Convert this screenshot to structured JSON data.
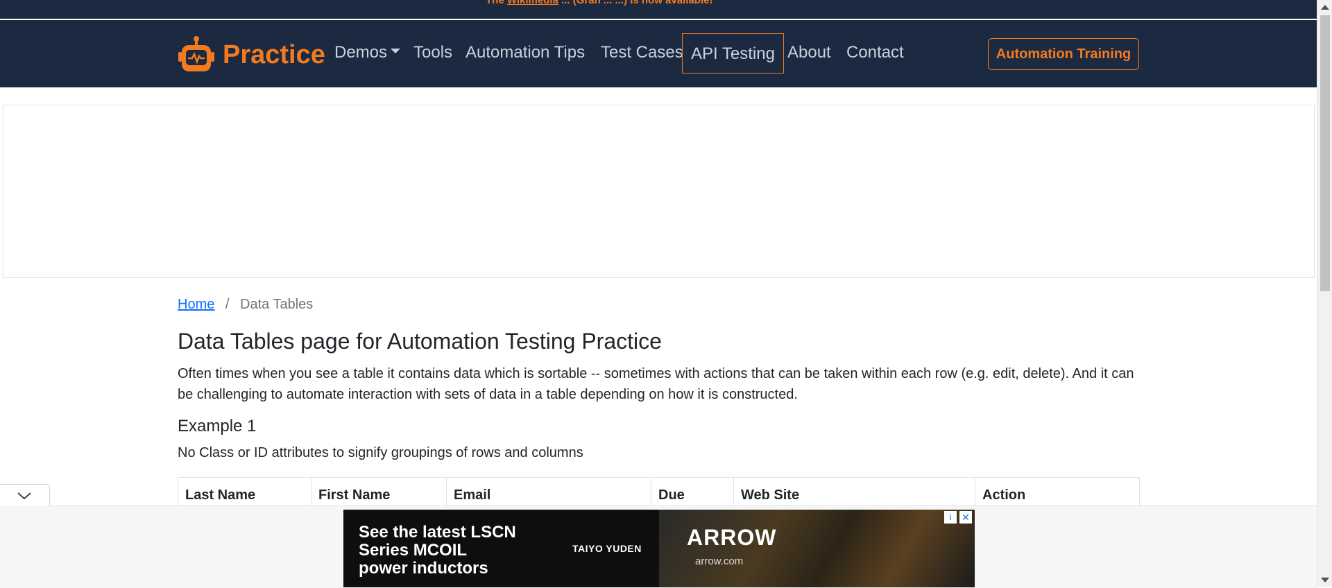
{
  "notice": {
    "prefix": "The",
    "link": "Wikimedia",
    "middle": "... (Gran ... ",
    "suffix": "...) is now available!"
  },
  "brand": {
    "name": "Practice",
    "icon": "robot-icon"
  },
  "nav": {
    "demos": "Demos",
    "tools": "Tools",
    "automation_tips": "Automation Tips",
    "test_cases": "Test Cases",
    "api_testing": "API Testing",
    "about": "About",
    "contact": "Contact",
    "training_button": "Automation Training"
  },
  "breadcrumb": {
    "home": "Home",
    "separator": "/",
    "current": "Data Tables"
  },
  "page": {
    "title": "Data Tables page for Automation Testing Practice",
    "intro": "Often times when you see a table it contains data which is sortable -- sometimes with actions that can be taken within each row (e.g. edit, delete). And it can be challenging to automate interaction with sets of data in a table depending on how it is constructed."
  },
  "example1": {
    "heading": "Example 1",
    "description": "No Class or ID attributes to signify groupings of rows and columns",
    "columns": [
      "Last Name",
      "First Name",
      "Email",
      "Due",
      "Web Site",
      "Action"
    ]
  },
  "ad": {
    "headline": "See the latest LSCN Series MCOIL power inductors",
    "sponsor": "TAIYO YUDEN",
    "logo": "ARROW",
    "domain": "arrow.com",
    "adchoices": "i",
    "close": "✕"
  },
  "colors": {
    "navbar": "#1b2a41",
    "accent": "#f47a20",
    "link": "#0d6efd"
  }
}
